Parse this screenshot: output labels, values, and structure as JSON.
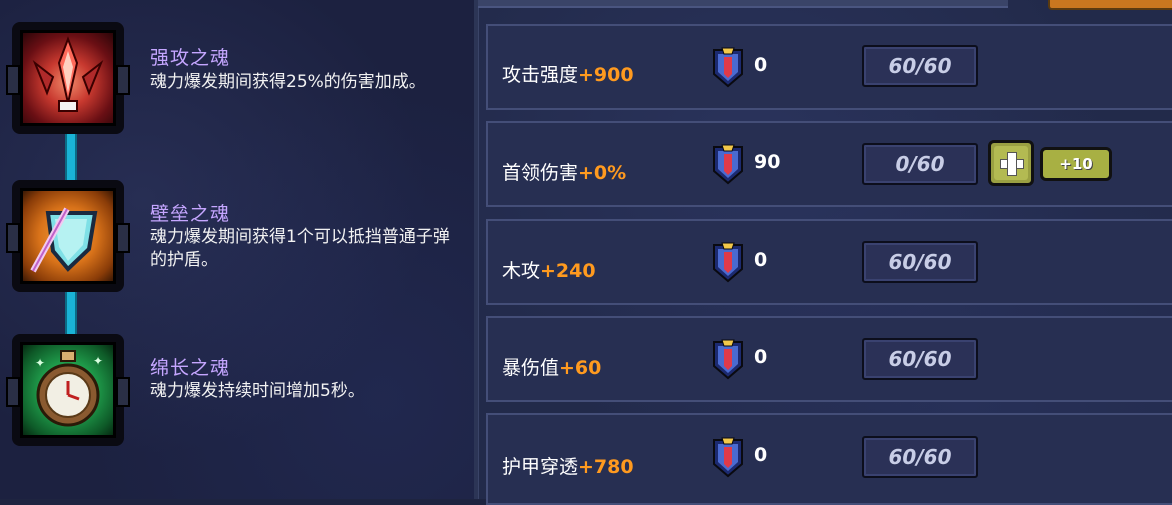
{
  "souls": [
    {
      "title": "强攻之魂",
      "desc": "魂力爆发期间获得25%的伤害加成。",
      "icon": "flame-sword-icon"
    },
    {
      "title": "壁垒之魂",
      "desc": "魂力爆发期间获得1个可以抵挡普通子弹的护盾。",
      "icon": "shield-icon"
    },
    {
      "title": "绵长之魂",
      "desc": "魂力爆发持续时间增加5秒。",
      "icon": "pocket-watch-icon"
    }
  ],
  "stats": [
    {
      "label": "攻击强度",
      "bonus": "+900",
      "gems": "0",
      "progress": "60/60"
    },
    {
      "label": "首领伤害",
      "bonus": "+0%",
      "gems": "90",
      "progress": "0/60"
    },
    {
      "label": "木攻",
      "bonus": "+240",
      "gems": "0",
      "progress": "60/60"
    },
    {
      "label": "暴伤值",
      "bonus": "+60",
      "gems": "0",
      "progress": "60/60"
    },
    {
      "label": "护甲穿透",
      "bonus": "+780",
      "gems": "0",
      "progress": "60/60"
    }
  ],
  "buttons": {
    "plus10_label": "+10"
  },
  "colors": {
    "bonus": "#ff9a1f",
    "soul_title": "#c5a6ff",
    "connector": "#1ab3d6"
  }
}
